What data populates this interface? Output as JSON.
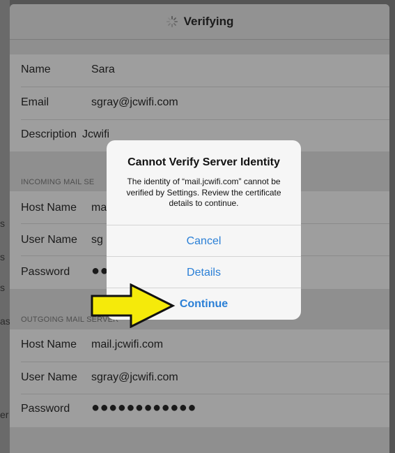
{
  "background_app": {
    "edge_fragments": [
      "s",
      "s",
      "s",
      "as",
      "er"
    ]
  },
  "nav": {
    "title": "Verifying"
  },
  "account": {
    "name": {
      "label": "Name",
      "value": "Sara"
    },
    "email": {
      "label": "Email",
      "value": "sgray@jcwifi.com"
    },
    "description": {
      "label": "Description",
      "value": "Jcwifi"
    }
  },
  "incoming": {
    "header": "INCOMING MAIL SE",
    "host": {
      "label": "Host Name",
      "value": "ma"
    },
    "user": {
      "label": "User Name",
      "value": "sg"
    },
    "password": {
      "label": "Password",
      "value": "●●"
    }
  },
  "outgoing": {
    "header": "OUTGOING MAIL SERVER",
    "host": {
      "label": "Host Name",
      "value": "mail.jcwifi.com"
    },
    "user": {
      "label": "User Name",
      "value": "sgray@jcwifi.com"
    },
    "password": {
      "label": "Password",
      "value": "●●●●●●●●●●●●"
    }
  },
  "dialog": {
    "title": "Cannot Verify Server Identity",
    "message": "The identity of “mail.jcwifi.com” cannot be verified by Settings. Review the certificate details to continue.",
    "cancel": "Cancel",
    "details": "Details",
    "continue": "Continue"
  },
  "colors": {
    "accent": "#2a7fd6",
    "arrow_fill": "#f5ea0a"
  }
}
